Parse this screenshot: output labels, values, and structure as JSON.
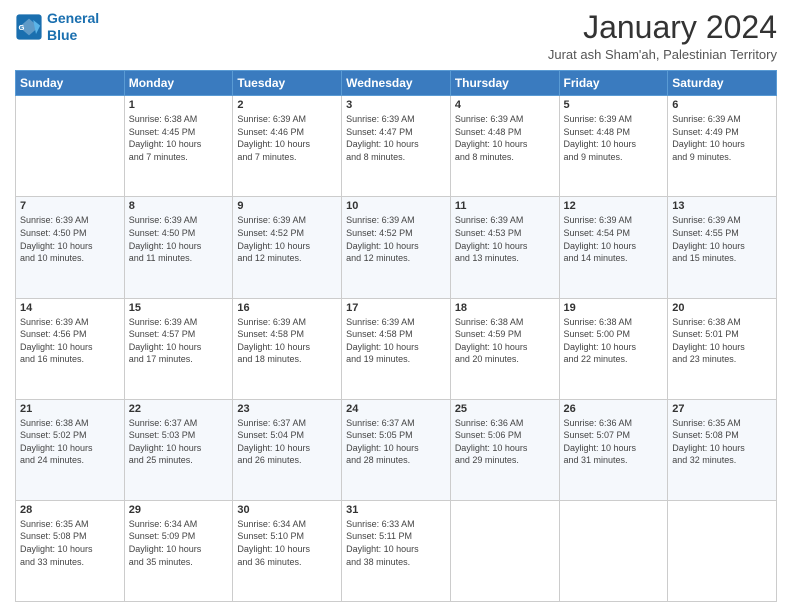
{
  "logo": {
    "line1": "General",
    "line2": "Blue"
  },
  "title": "January 2024",
  "subtitle": "Jurat ash Sham'ah, Palestinian Territory",
  "header_row": [
    "Sunday",
    "Monday",
    "Tuesday",
    "Wednesday",
    "Thursday",
    "Friday",
    "Saturday"
  ],
  "weeks": [
    [
      {
        "day": "",
        "info": ""
      },
      {
        "day": "1",
        "info": "Sunrise: 6:38 AM\nSunset: 4:45 PM\nDaylight: 10 hours\nand 7 minutes."
      },
      {
        "day": "2",
        "info": "Sunrise: 6:39 AM\nSunset: 4:46 PM\nDaylight: 10 hours\nand 7 minutes."
      },
      {
        "day": "3",
        "info": "Sunrise: 6:39 AM\nSunset: 4:47 PM\nDaylight: 10 hours\nand 8 minutes."
      },
      {
        "day": "4",
        "info": "Sunrise: 6:39 AM\nSunset: 4:48 PM\nDaylight: 10 hours\nand 8 minutes."
      },
      {
        "day": "5",
        "info": "Sunrise: 6:39 AM\nSunset: 4:48 PM\nDaylight: 10 hours\nand 9 minutes."
      },
      {
        "day": "6",
        "info": "Sunrise: 6:39 AM\nSunset: 4:49 PM\nDaylight: 10 hours\nand 9 minutes."
      }
    ],
    [
      {
        "day": "7",
        "info": "Sunrise: 6:39 AM\nSunset: 4:50 PM\nDaylight: 10 hours\nand 10 minutes."
      },
      {
        "day": "8",
        "info": "Sunrise: 6:39 AM\nSunset: 4:50 PM\nDaylight: 10 hours\nand 11 minutes."
      },
      {
        "day": "9",
        "info": "Sunrise: 6:39 AM\nSunset: 4:52 PM\nDaylight: 10 hours\nand 12 minutes."
      },
      {
        "day": "10",
        "info": "Sunrise: 6:39 AM\nSunset: 4:52 PM\nDaylight: 10 hours\nand 12 minutes."
      },
      {
        "day": "11",
        "info": "Sunrise: 6:39 AM\nSunset: 4:53 PM\nDaylight: 10 hours\nand 13 minutes."
      },
      {
        "day": "12",
        "info": "Sunrise: 6:39 AM\nSunset: 4:54 PM\nDaylight: 10 hours\nand 14 minutes."
      },
      {
        "day": "13",
        "info": "Sunrise: 6:39 AM\nSunset: 4:55 PM\nDaylight: 10 hours\nand 15 minutes."
      }
    ],
    [
      {
        "day": "14",
        "info": "Sunrise: 6:39 AM\nSunset: 4:56 PM\nDaylight: 10 hours\nand 16 minutes."
      },
      {
        "day": "15",
        "info": "Sunrise: 6:39 AM\nSunset: 4:57 PM\nDaylight: 10 hours\nand 17 minutes."
      },
      {
        "day": "16",
        "info": "Sunrise: 6:39 AM\nSunset: 4:58 PM\nDaylight: 10 hours\nand 18 minutes."
      },
      {
        "day": "17",
        "info": "Sunrise: 6:39 AM\nSunset: 4:58 PM\nDaylight: 10 hours\nand 19 minutes."
      },
      {
        "day": "18",
        "info": "Sunrise: 6:38 AM\nSunset: 4:59 PM\nDaylight: 10 hours\nand 20 minutes."
      },
      {
        "day": "19",
        "info": "Sunrise: 6:38 AM\nSunset: 5:00 PM\nDaylight: 10 hours\nand 22 minutes."
      },
      {
        "day": "20",
        "info": "Sunrise: 6:38 AM\nSunset: 5:01 PM\nDaylight: 10 hours\nand 23 minutes."
      }
    ],
    [
      {
        "day": "21",
        "info": "Sunrise: 6:38 AM\nSunset: 5:02 PM\nDaylight: 10 hours\nand 24 minutes."
      },
      {
        "day": "22",
        "info": "Sunrise: 6:37 AM\nSunset: 5:03 PM\nDaylight: 10 hours\nand 25 minutes."
      },
      {
        "day": "23",
        "info": "Sunrise: 6:37 AM\nSunset: 5:04 PM\nDaylight: 10 hours\nand 26 minutes."
      },
      {
        "day": "24",
        "info": "Sunrise: 6:37 AM\nSunset: 5:05 PM\nDaylight: 10 hours\nand 28 minutes."
      },
      {
        "day": "25",
        "info": "Sunrise: 6:36 AM\nSunset: 5:06 PM\nDaylight: 10 hours\nand 29 minutes."
      },
      {
        "day": "26",
        "info": "Sunrise: 6:36 AM\nSunset: 5:07 PM\nDaylight: 10 hours\nand 31 minutes."
      },
      {
        "day": "27",
        "info": "Sunrise: 6:35 AM\nSunset: 5:08 PM\nDaylight: 10 hours\nand 32 minutes."
      }
    ],
    [
      {
        "day": "28",
        "info": "Sunrise: 6:35 AM\nSunset: 5:08 PM\nDaylight: 10 hours\nand 33 minutes."
      },
      {
        "day": "29",
        "info": "Sunrise: 6:34 AM\nSunset: 5:09 PM\nDaylight: 10 hours\nand 35 minutes."
      },
      {
        "day": "30",
        "info": "Sunrise: 6:34 AM\nSunset: 5:10 PM\nDaylight: 10 hours\nand 36 minutes."
      },
      {
        "day": "31",
        "info": "Sunrise: 6:33 AM\nSunset: 5:11 PM\nDaylight: 10 hours\nand 38 minutes."
      },
      {
        "day": "",
        "info": ""
      },
      {
        "day": "",
        "info": ""
      },
      {
        "day": "",
        "info": ""
      }
    ]
  ]
}
